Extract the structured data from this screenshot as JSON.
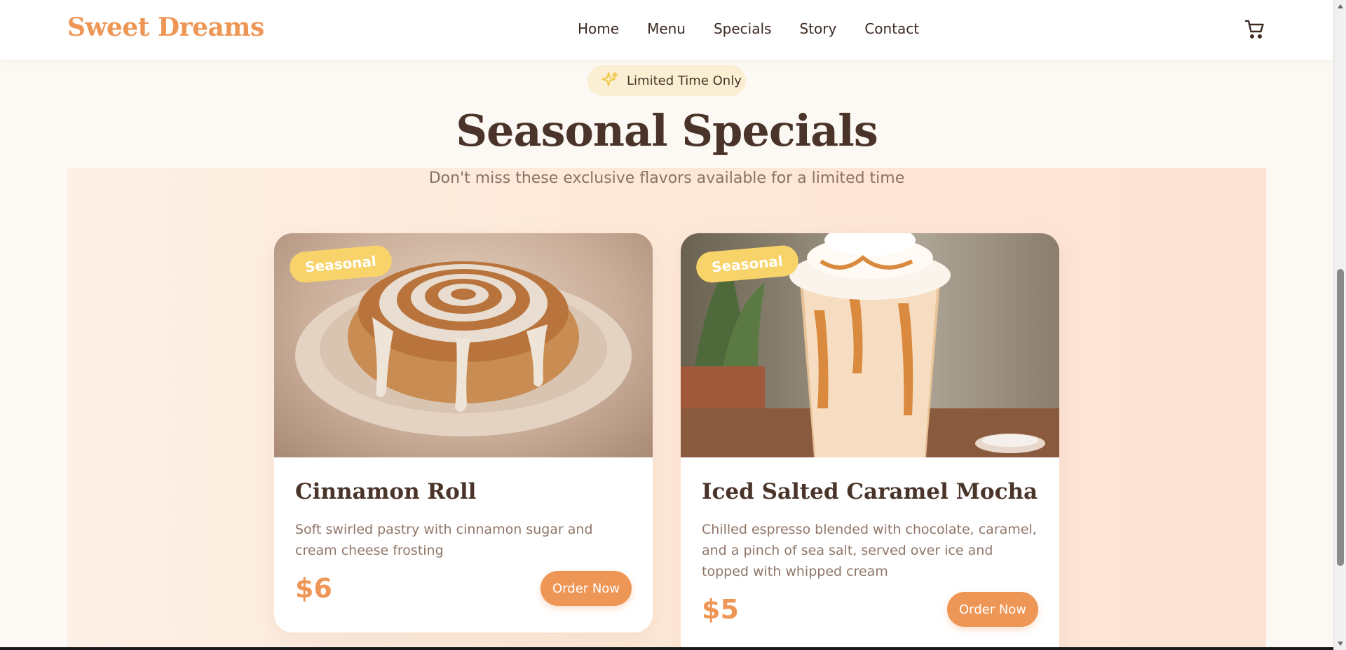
{
  "header": {
    "brand": "Sweet Dreams",
    "nav": [
      "Home",
      "Menu",
      "Specials",
      "Story",
      "Contact"
    ],
    "cart_icon": "cart-icon"
  },
  "section": {
    "pill_text": "Limited Time Only",
    "pill_icon": "sparkle-icon",
    "title": "Seasonal Specials",
    "subtitle": "Don't miss these exclusive flavors available for a limited time"
  },
  "cards": [
    {
      "badge": "Seasonal",
      "title": "Cinnamon Roll",
      "description": "Soft swirled pastry with cinnamon sugar and cream cheese frosting",
      "price": "$6",
      "button": "Order Now"
    },
    {
      "badge": "Seasonal",
      "title": "Iced Salted Caramel Mocha",
      "description": "Chilled espresso blended with chocolate, caramel, and a pinch of sea salt, served over ice and topped with whipped cream",
      "price": "$5",
      "button": "Order Now"
    }
  ],
  "colors": {
    "accent": "#ee9656",
    "badge": "#f7d36a",
    "text": "#4a3328"
  }
}
